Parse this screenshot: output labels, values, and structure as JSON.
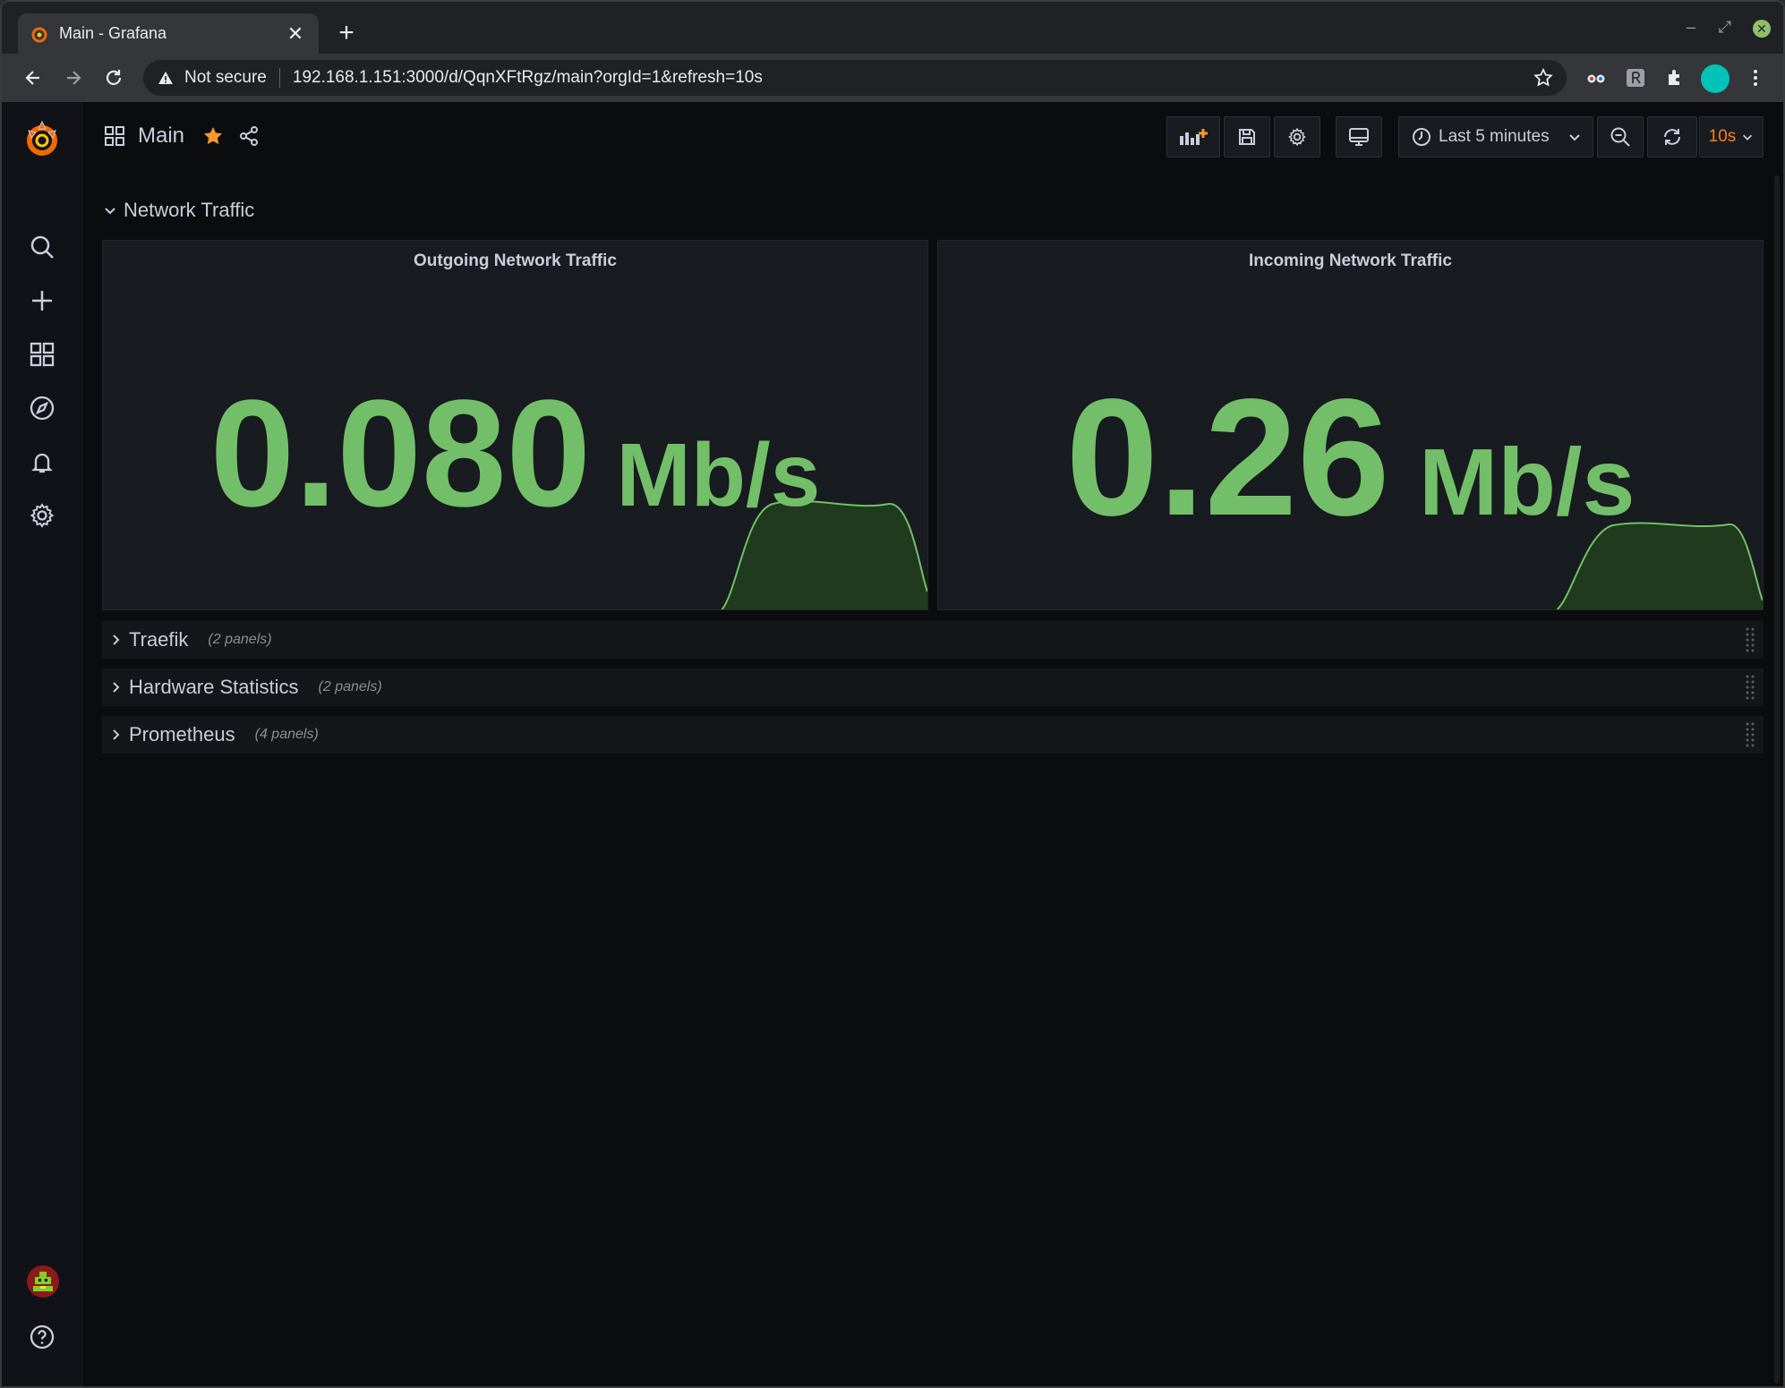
{
  "browser": {
    "tab_title": "Main - Grafana",
    "tab_close": "✕",
    "new_tab": "+",
    "security_label": "Not secure",
    "url": "192.168.1.151:3000/d/QqnXFtRgz/main?orgId=1&refresh=10s",
    "window_minimize": "–",
    "window_restore": "⤢",
    "window_close": "✕",
    "profile_color": "#00c2b8"
  },
  "dashboard": {
    "title": "Main",
    "time_range": "Last 5 minutes",
    "refresh_interval": "10s"
  },
  "sections": {
    "network": {
      "title": "Network Traffic"
    }
  },
  "panels": [
    {
      "title": "Outgoing Network Traffic",
      "value": "0.080",
      "unit": "Mb/s"
    },
    {
      "title": "Incoming Network Traffic",
      "value": "0.26",
      "unit": "Mb/s"
    }
  ],
  "rows": [
    {
      "title": "Traefik",
      "count": "(2 panels)"
    },
    {
      "title": "Hardware Statistics",
      "count": "(2 panels)"
    },
    {
      "title": "Prometheus",
      "count": "(4 panels)"
    }
  ],
  "colors": {
    "value_green": "#73bf69",
    "accent_orange": "#ff7d1a",
    "bg": "#0b0c0e",
    "panel_bg": "#181b1f"
  },
  "icons": {
    "sidemenu": [
      "grafana-logo-icon",
      "search-icon",
      "plus-icon",
      "dashboards-icon",
      "explore-icon",
      "alerting-icon",
      "settings-icon",
      "user-avatar-icon",
      "help-icon"
    ],
    "toolbar": [
      "add-panel-icon",
      "save-icon",
      "dashboard-settings-icon",
      "tv-mode-icon",
      "clock-icon",
      "zoom-out-icon",
      "refresh-icon"
    ]
  }
}
